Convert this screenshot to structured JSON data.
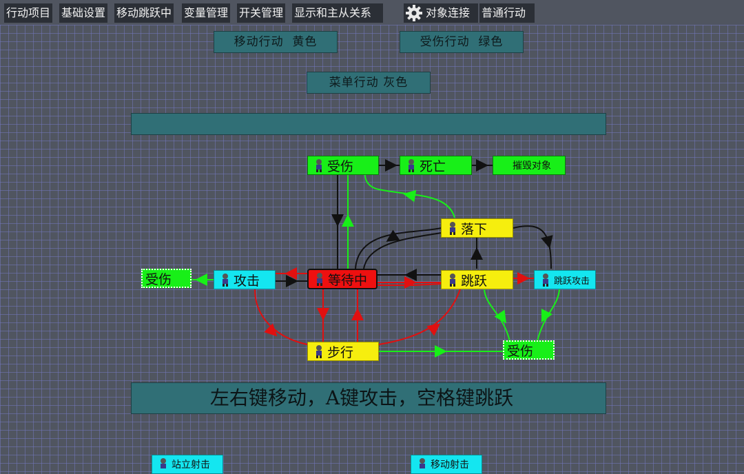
{
  "tabs": [
    {
      "label": "行动项目"
    },
    {
      "label": "基础设置"
    },
    {
      "label": "移动跳跃中"
    },
    {
      "label": "变量管理"
    },
    {
      "label": "开关管理"
    },
    {
      "label": "显示和主从关系"
    },
    {
      "label": "对象连接",
      "icon": "gear-icon"
    },
    {
      "label": "普通行动"
    }
  ],
  "legend": {
    "move": "移动行动  黄色",
    "hurt": "受伤行动  绿色",
    "menu": "菜单行动 灰色"
  },
  "nodes": {
    "hurt_top": "受伤",
    "death": "死亡",
    "destroy": "摧毁对象",
    "fall": "落下",
    "hurt_left": "受伤",
    "attack": "攻击",
    "waiting": "等待中",
    "jump": "跳跃",
    "jump_attack": "跳跃攻击",
    "walk": "步行",
    "hurt_right": "受伤",
    "bottom_left": "站立射击",
    "bottom_right": "移动射击"
  },
  "instruction": "左右键移动，A键攻击，空格键跳跃",
  "colors": {
    "background": "#505560",
    "grid": "#7378be",
    "tab_bg": "#2b2f36",
    "teal_box": "#306f76",
    "green": "#18ef18",
    "yellow": "#f6ee0e",
    "cyan": "#14e6f0",
    "red": "#ee1010"
  }
}
